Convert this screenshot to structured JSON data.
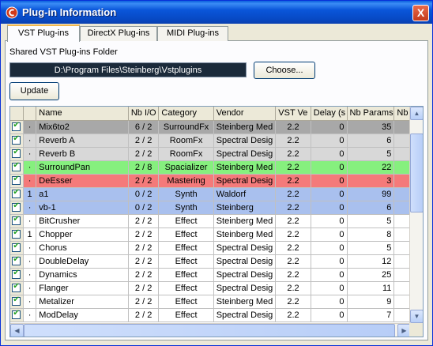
{
  "window": {
    "title": "Plug-in Information",
    "close_label": "X"
  },
  "tabs": [
    "VST Plug-ins",
    "DirectX Plug-ins",
    "MIDI Plug-ins"
  ],
  "shared_folder": {
    "label": "Shared VST Plug-ins Folder",
    "path": "D:\\Program Files\\Steinberg\\Vstplugins",
    "choose_label": "Choose..."
  },
  "update_label": "Update",
  "table": {
    "columns": [
      "",
      "",
      "Name",
      "Nb I/O",
      "Category",
      "Vendor",
      "VST Ve",
      "Delay (s",
      "Nb Params",
      "Nb Pr"
    ],
    "rows": [
      {
        "active": "·",
        "name": "Mix6to2",
        "io": "6 / 2",
        "category": "SurroundFx",
        "vendor": "Steinberg Med",
        "vst": "2.2",
        "delay": "0",
        "params": "35",
        "bg": "#a8a8a8"
      },
      {
        "active": "·",
        "name": "Reverb A",
        "io": "2 / 2",
        "category": "RoomFx",
        "vendor": "Spectral Desig",
        "vst": "2.2",
        "delay": "0",
        "params": "6",
        "bg": "#d8d8d8"
      },
      {
        "active": "·",
        "name": "Reverb B",
        "io": "2 / 2",
        "category": "RoomFx",
        "vendor": "Spectral Desig",
        "vst": "2.2",
        "delay": "0",
        "params": "5",
        "bg": "#d8d8d8"
      },
      {
        "active": "·",
        "name": "SurroundPan",
        "io": "2 / 8",
        "category": "Spacializer",
        "vendor": "Steinberg Med",
        "vst": "2.2",
        "delay": "0",
        "params": "22",
        "bg": "#86f07e"
      },
      {
        "active": "·",
        "name": "DeEsser",
        "io": "2 / 2",
        "category": "Mastering",
        "vendor": "Spectral Desig",
        "vst": "2.2",
        "delay": "0",
        "params": "3",
        "bg": "#f47a7a"
      },
      {
        "active": "1",
        "name": "a1",
        "io": "0 / 2",
        "category": "Synth",
        "vendor": "Waldorf",
        "vst": "2.2",
        "delay": "0",
        "params": "99",
        "bg": "#a9c0ee"
      },
      {
        "active": "·",
        "name": "vb-1",
        "io": "0 / 2",
        "category": "Synth",
        "vendor": "Steinberg",
        "vst": "2.2",
        "delay": "0",
        "params": "6",
        "bg": "#a9c0ee"
      },
      {
        "active": "·",
        "name": "BitCrusher",
        "io": "2 / 2",
        "category": "Effect",
        "vendor": "Steinberg Med",
        "vst": "2.2",
        "delay": "0",
        "params": "5",
        "bg": "#ffffff"
      },
      {
        "active": "1",
        "name": "Chopper",
        "io": "2 / 2",
        "category": "Effect",
        "vendor": "Steinberg Med",
        "vst": "2.2",
        "delay": "0",
        "params": "8",
        "bg": "#ffffff"
      },
      {
        "active": "·",
        "name": "Chorus",
        "io": "2 / 2",
        "category": "Effect",
        "vendor": "Spectral Desig",
        "vst": "2.2",
        "delay": "0",
        "params": "5",
        "bg": "#ffffff"
      },
      {
        "active": "·",
        "name": "DoubleDelay",
        "io": "2 / 2",
        "category": "Effect",
        "vendor": "Spectral Desig",
        "vst": "2.2",
        "delay": "0",
        "params": "12",
        "bg": "#ffffff"
      },
      {
        "active": "·",
        "name": "Dynamics",
        "io": "2 / 2",
        "category": "Effect",
        "vendor": "Spectral Desig",
        "vst": "2.2",
        "delay": "0",
        "params": "25",
        "bg": "#ffffff"
      },
      {
        "active": "·",
        "name": "Flanger",
        "io": "2 / 2",
        "category": "Effect",
        "vendor": "Spectral Desig",
        "vst": "2.2",
        "delay": "0",
        "params": "11",
        "bg": "#ffffff"
      },
      {
        "active": "·",
        "name": "Metalizer",
        "io": "2 / 2",
        "category": "Effect",
        "vendor": "Steinberg Med",
        "vst": "2.2",
        "delay": "0",
        "params": "9",
        "bg": "#ffffff"
      },
      {
        "active": "·",
        "name": "ModDelay",
        "io": "2 / 2",
        "category": "Effect",
        "vendor": "Spectral Desig",
        "vst": "2.2",
        "delay": "0",
        "params": "7",
        "bg": "#ffffff"
      }
    ]
  }
}
